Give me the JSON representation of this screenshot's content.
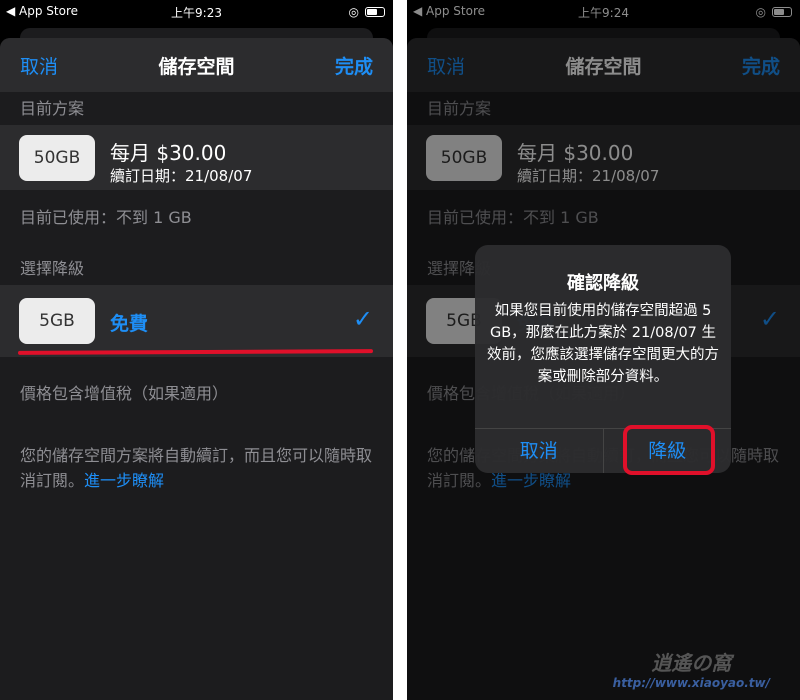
{
  "left": {
    "status": {
      "carrier": "◀ App Store",
      "time": "上午9:23"
    }
  },
  "right": {
    "status": {
      "carrier": "◀ App Store",
      "time": "上午9:24"
    }
  },
  "nav": {
    "cancel": "取消",
    "title": "儲存空間",
    "done": "完成"
  },
  "current_plan": {
    "header": "目前方案",
    "size": "50GB",
    "price": "每月 $30.00",
    "renewal": "續訂日期：21/08/07",
    "usage": "目前已使用：不到 1 GB"
  },
  "downgrade": {
    "header": "選擇降級",
    "size": "5GB",
    "price": "免費",
    "selected": true,
    "tax_note": "價格包含增值稅（如果適用）"
  },
  "footer": {
    "text": "您的儲存空間方案將自動續訂，而且您可以隨時取消訂閱。",
    "link": "進一步瞭解"
  },
  "alert": {
    "title": "確認降級",
    "message": "如果您目前使用的儲存空間超過 5 GB，那麼在此方案於 21/08/07 生效前，您應該選擇儲存空間更大的方案或刪除部分資料。",
    "cancel": "取消",
    "confirm": "降級"
  },
  "highlight_color": "#e0102a",
  "accent": "#1e8ef5",
  "watermark": {
    "logo": "逍遙の窩",
    "url": "http://www.xiaoyao.tw/"
  }
}
